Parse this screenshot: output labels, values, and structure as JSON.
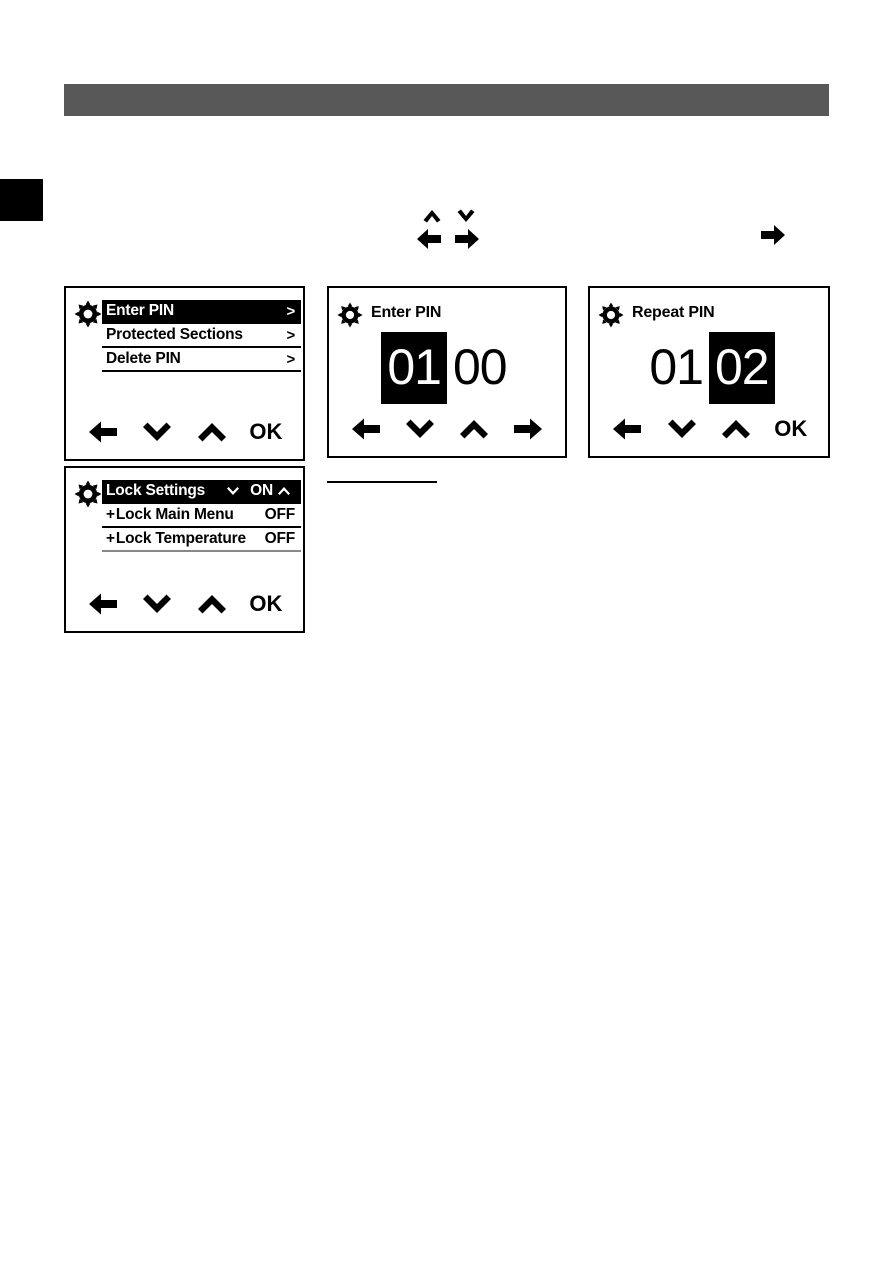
{
  "page": {
    "header_bar_color": "#585858",
    "edge_tab_color": "#000000"
  },
  "navigation_glyphs": {
    "cluster": [
      {
        "name": "chevron-up-icon",
        "label": "up"
      },
      {
        "name": "chevron-down-icon",
        "label": "down"
      },
      {
        "name": "arrow-left-icon",
        "label": "left"
      },
      {
        "name": "arrow-right-icon",
        "label": "right"
      }
    ],
    "standalone": {
      "name": "arrow-right-icon",
      "label": "right"
    }
  },
  "panels": [
    {
      "id": "pin-menu",
      "type": "menu",
      "icon": "gear-icon",
      "rows": [
        {
          "label": "Enter PIN",
          "chevron": ">",
          "selected": true
        },
        {
          "label": "Protected Sections",
          "chevron": ">",
          "selected": false
        },
        {
          "label": "Delete PIN",
          "chevron": ">",
          "selected": false
        }
      ],
      "softkeys": [
        "arrow-left-icon",
        "chevron-down-icon",
        "chevron-up-icon",
        "OK"
      ],
      "ok_label": "OK"
    },
    {
      "id": "enter-pin",
      "type": "pin",
      "icon": "gear-icon",
      "title": "Enter PIN",
      "digits": [
        {
          "value": "01",
          "active": true
        },
        {
          "value": "00",
          "active": false
        }
      ],
      "softkeys": [
        "arrow-left-icon",
        "chevron-down-icon",
        "chevron-up-icon",
        "arrow-right-icon"
      ],
      "ok_label": ""
    },
    {
      "id": "repeat-pin",
      "type": "pin",
      "icon": "gear-icon",
      "title": "Repeat PIN",
      "digits": [
        {
          "value": "01",
          "active": false
        },
        {
          "value": "02",
          "active": true
        }
      ],
      "softkeys": [
        "arrow-left-icon",
        "chevron-down-icon",
        "chevron-up-icon",
        "OK"
      ],
      "ok_label": "OK"
    },
    {
      "id": "lock-settings",
      "type": "menu",
      "icon": "gear-icon",
      "rows": [
        {
          "label": "Lock Settings",
          "value": "ON",
          "selected": true,
          "mini_chevrons": true
        },
        {
          "label": "Lock Main Menu",
          "value": "OFF",
          "selected": false,
          "plus": "+"
        },
        {
          "label": "Lock Temperature",
          "value": "OFF",
          "selected": false,
          "plus": "+"
        }
      ],
      "softkeys": [
        "arrow-left-icon",
        "chevron-down-icon",
        "chevron-up-icon",
        "OK"
      ],
      "ok_label": "OK"
    }
  ],
  "labels": {
    "ok": "OK",
    "on": "ON",
    "off": "OFF",
    "plus": "+",
    "chevron_right": ">"
  }
}
